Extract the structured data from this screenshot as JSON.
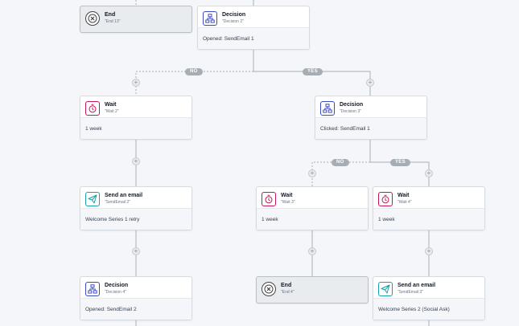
{
  "nodes": {
    "end_13": {
      "title": "End",
      "subtitle": "\"End 13\""
    },
    "decision_2": {
      "title": "Decision",
      "subtitle": "\"Decision 2\"",
      "detail": "Opened: SendEmail 1"
    },
    "wait_2": {
      "title": "Wait",
      "subtitle": "\"Wait 2\"",
      "detail": "1 week"
    },
    "decision_3": {
      "title": "Decision",
      "subtitle": "\"Decision 3\"",
      "detail": "Clicked: SendEmail 1"
    },
    "send_email_2": {
      "title": "Send an email",
      "subtitle": "\"SendEmail 2\"",
      "detail": "Welcome Series 1 retry"
    },
    "wait_3": {
      "title": "Wait",
      "subtitle": "\"Wait 3\"",
      "detail": "1 week"
    },
    "wait_4": {
      "title": "Wait",
      "subtitle": "\"Wait 4\"",
      "detail": "1 week"
    },
    "decision_4": {
      "title": "Decision",
      "subtitle": "\"Decision 4\"",
      "detail": "Opened: SendEmail 2"
    },
    "end_4": {
      "title": "End",
      "subtitle": "\"End 4\""
    },
    "send_email_3": {
      "title": "Send an email",
      "subtitle": "\"SendEmail 3\"",
      "detail": "Welcome Series 2 (Social Ask)"
    }
  },
  "branches": {
    "decision_2_no": "NO",
    "decision_2_yes": "YES",
    "decision_3_no": "NO",
    "decision_3_yes": "YES"
  },
  "add_step_symbol": "+",
  "colors": {
    "decision": "#3b4cc0",
    "wait": "#c2185b",
    "email": "#1aa1a8",
    "end": "#444444",
    "connector": "#b6bcc4",
    "branch_pill": "#a7adb5"
  },
  "icons": {
    "decision": "flowchart-icon",
    "wait": "stopwatch-icon",
    "email": "paper-plane-icon",
    "end": "x-circle-icon"
  }
}
